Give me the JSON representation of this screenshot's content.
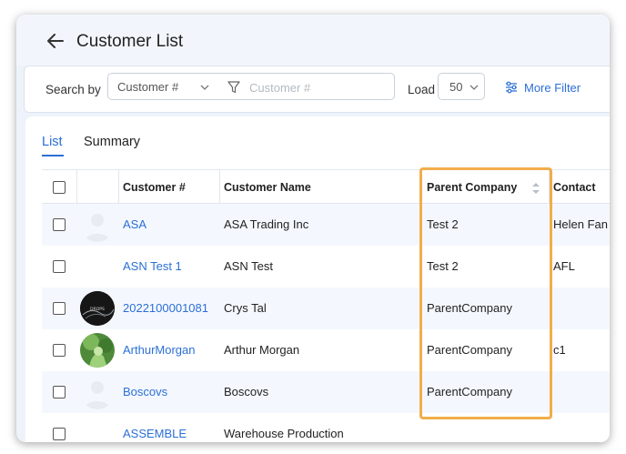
{
  "header": {
    "title": "Customer List"
  },
  "search": {
    "label": "Search by",
    "field_value": "Customer #",
    "placeholder": "Customer #",
    "load_label": "Load",
    "load_value": "50",
    "more_filter_label": "More Filter"
  },
  "tabs": [
    {
      "label": "List"
    },
    {
      "label": "Summary"
    }
  ],
  "table": {
    "columns": [
      "Customer #",
      "Customer Name",
      "Parent Company",
      "Contact"
    ],
    "rows": [
      {
        "customer_no": "ASA",
        "name": "ASA Trading Inc",
        "parent": "Test 2",
        "contact": "Helen Fan",
        "avatar": "placeholder"
      },
      {
        "customer_no": "ASN Test 1",
        "name": "ASN Test",
        "parent": "Test 2",
        "contact": "AFL",
        "avatar": "none"
      },
      {
        "customer_no": "2022100001081",
        "name": "Crys Tal",
        "parent": "ParentCompany",
        "contact": "",
        "avatar": "dark-photo"
      },
      {
        "customer_no": "ArthurMorgan",
        "name": "Arthur Morgan",
        "parent": "ParentCompany",
        "contact": "c1",
        "avatar": "green-photo"
      },
      {
        "customer_no": "Boscovs",
        "name": "Boscovs",
        "parent": "ParentCompany",
        "contact": "",
        "avatar": "placeholder"
      },
      {
        "customer_no": "ASSEMBLE",
        "name": "Warehouse Production",
        "parent": "",
        "contact": "",
        "avatar": "none"
      }
    ]
  },
  "colors": {
    "accent": "#2b6fd6",
    "highlight": "#f1ad4b",
    "row_alt": "#f4f8fe"
  }
}
